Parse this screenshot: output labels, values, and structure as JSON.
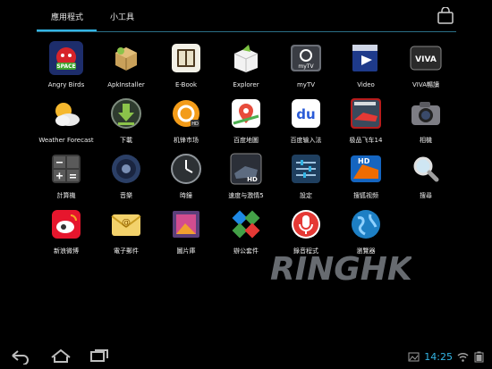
{
  "tabs": [
    {
      "label": "應用程式",
      "active": true
    },
    {
      "label": "小工具",
      "active": false
    }
  ],
  "accent_color": "#33b5e5",
  "apps": [
    {
      "label": "Angry Birds",
      "icon": "angry-birds-icon"
    },
    {
      "label": "ApkInstaller",
      "icon": "apk-installer-icon"
    },
    {
      "label": "E-Book",
      "icon": "ebook-icon"
    },
    {
      "label": "Explorer",
      "icon": "explorer-icon"
    },
    {
      "label": "myTV",
      "icon": "mytv-icon"
    },
    {
      "label": "Video",
      "icon": "video-icon"
    },
    {
      "label": "VIVA暢讀",
      "icon": "viva-icon"
    },
    {
      "label": "Weather Forecast",
      "icon": "weather-icon"
    },
    {
      "label": "下載",
      "icon": "download-icon"
    },
    {
      "label": "机锋市场",
      "icon": "gfan-market-icon"
    },
    {
      "label": "百度地圖",
      "icon": "baidu-map-icon"
    },
    {
      "label": "百度输入法",
      "icon": "baidu-input-icon"
    },
    {
      "label": "极品飞车14",
      "icon": "need-for-speed-icon"
    },
    {
      "label": "相機",
      "icon": "camera-icon"
    },
    {
      "label": "計算機",
      "icon": "calculator-icon"
    },
    {
      "label": "音樂",
      "icon": "music-icon"
    },
    {
      "label": "時鐘",
      "icon": "clock-icon"
    },
    {
      "label": "速度与激情5",
      "icon": "fast-five-icon"
    },
    {
      "label": "設定",
      "icon": "settings-icon"
    },
    {
      "label": "搜狐视频",
      "icon": "sohu-video-icon"
    },
    {
      "label": "搜尋",
      "icon": "search-icon"
    },
    {
      "label": "新浪微博",
      "icon": "weibo-icon"
    },
    {
      "label": "電子郵件",
      "icon": "email-icon"
    },
    {
      "label": "圖片庫",
      "icon": "gallery-icon"
    },
    {
      "label": "辦公套件",
      "icon": "office-suite-icon"
    },
    {
      "label": "錄音程式",
      "icon": "sound-recorder-icon"
    },
    {
      "label": "瀏覽器",
      "icon": "browser-icon"
    }
  ],
  "watermark": {
    "text": "RINGHK"
  },
  "status": {
    "time": "14:25"
  },
  "nav": {
    "back": "back-icon",
    "home": "home-icon",
    "recents": "recent-apps-icon"
  }
}
